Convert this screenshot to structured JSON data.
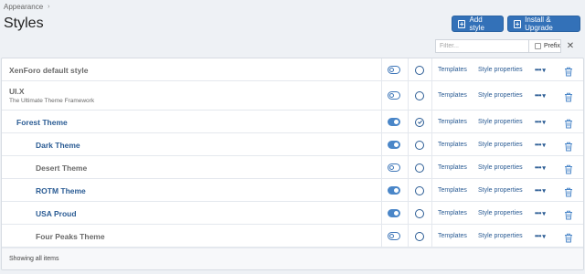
{
  "breadcrumb": {
    "items": [
      "Appearance"
    ]
  },
  "page": {
    "title": "Styles"
  },
  "toolbar": {
    "add_style": "Add style",
    "install_upgrade": "Install & Upgrade"
  },
  "filter": {
    "placeholder": "Filter...",
    "prefix_label": "Prefix"
  },
  "styles": [
    {
      "name": "XenForo default style",
      "description": "",
      "enabled": false,
      "selected": false,
      "level": 0
    },
    {
      "name": "UI.X",
      "description": "The Ultimate Theme Framework",
      "enabled": false,
      "selected": false,
      "level": 0
    },
    {
      "name": "Forest Theme",
      "description": "",
      "enabled": true,
      "selected": true,
      "level": 1
    },
    {
      "name": "Dark Theme",
      "description": "",
      "enabled": true,
      "selected": false,
      "level": 2
    },
    {
      "name": "Desert Theme",
      "description": "",
      "enabled": false,
      "selected": false,
      "level": 2
    },
    {
      "name": "ROTM Theme",
      "description": "",
      "enabled": true,
      "selected": false,
      "level": 2
    },
    {
      "name": "USA Proud",
      "description": "",
      "enabled": true,
      "selected": false,
      "level": 2
    },
    {
      "name": "Four Peaks Theme",
      "description": "",
      "enabled": false,
      "selected": false,
      "level": 2
    }
  ],
  "row_actions": {
    "templates": "Templates",
    "properties": "Style properties",
    "more": "•••"
  },
  "footer": {
    "status": "Showing all items"
  },
  "colors": {
    "accent": "#3371b8",
    "link": "#2b5c94",
    "toggle_on": "#4a86c8"
  }
}
